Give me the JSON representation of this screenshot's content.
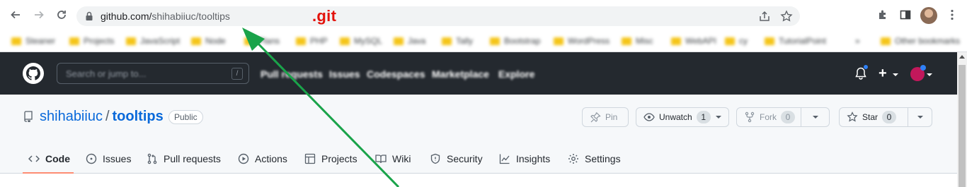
{
  "browser": {
    "url_host": "github.com/",
    "url_path": "shihabiiuc/tooltips",
    "annotation": ".git",
    "bookmarks": [
      "Steaner",
      "Projects",
      "JavaScript",
      "Node",
      "Plans",
      "PHP",
      "MySQL",
      "Java",
      "Tally",
      "Bootstrap",
      "WordPress",
      "Misc",
      "WebAPI",
      "cy",
      "TutorialPoint",
      "»",
      "Other bookmarks"
    ]
  },
  "github": {
    "search_placeholder": "Search or jump to...",
    "search_shortcut": "/",
    "nav": [
      "Pull requests",
      "Issues",
      "Codespaces",
      "Marketplace",
      "Explore"
    ],
    "plus_label": "+"
  },
  "repo": {
    "owner": "shihabiiuc",
    "separator": "/",
    "name": "tooltips",
    "visibility": "Public",
    "pin_label": "Pin",
    "unwatch_label": "Unwatch",
    "watch_count": "1",
    "fork_label": "Fork",
    "fork_count": "0",
    "star_label": "Star",
    "star_count": "0",
    "tabs": [
      "Code",
      "Issues",
      "Pull requests",
      "Actions",
      "Projects",
      "Wiki",
      "Security",
      "Insights",
      "Settings"
    ]
  },
  "colors": {
    "annotation": "#e3120b",
    "arrow": "#1aa34a",
    "header_bg": "#24292f",
    "link_blue": "#0969da",
    "active_tab": "#fd8c73"
  }
}
